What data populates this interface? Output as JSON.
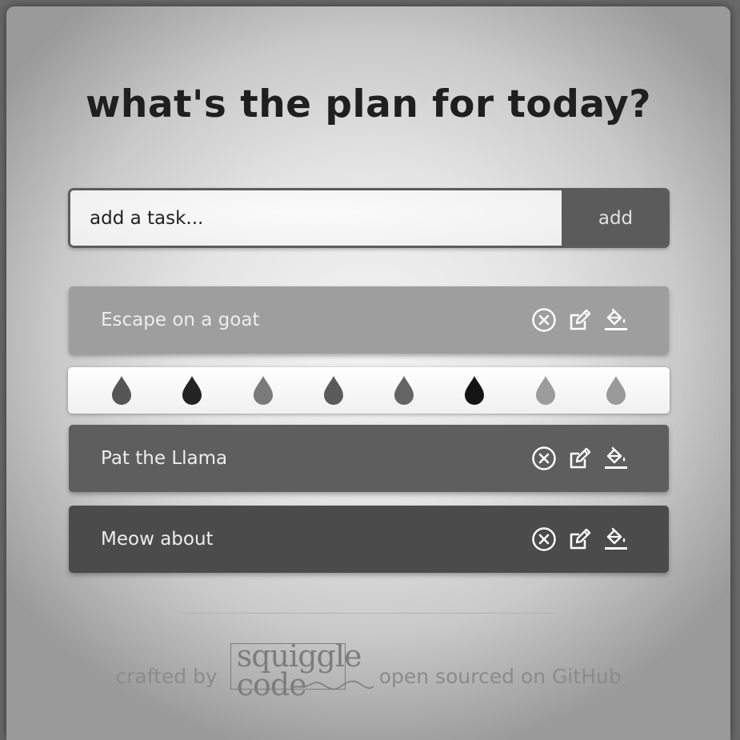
{
  "header": {
    "title": "what's the plan for today?"
  },
  "task_form": {
    "placeholder": "add a task...",
    "add_label": "add"
  },
  "tasks": [
    {
      "text": "Escape on a goat",
      "color": "#9e9e9e"
    },
    {
      "text": "Pat the Llama",
      "color": "#5e5e5e"
    },
    {
      "text": "Meow about",
      "color": "#4b4b4b"
    }
  ],
  "palette": {
    "colors": [
      "#565656",
      "#232323",
      "#7a7a7a",
      "#5a5a5a",
      "#646464",
      "#141414",
      "#9c9c9c",
      "#9a9a9a"
    ]
  },
  "task_action_icons": [
    "delete-circle-x-icon",
    "edit-pencil-icon",
    "paint-bucket-icon"
  ],
  "footer": {
    "crafted_by": "crafted by",
    "logo_line1": "squiggle",
    "logo_line2": "code",
    "github_text": "open sourced on GitHub"
  }
}
